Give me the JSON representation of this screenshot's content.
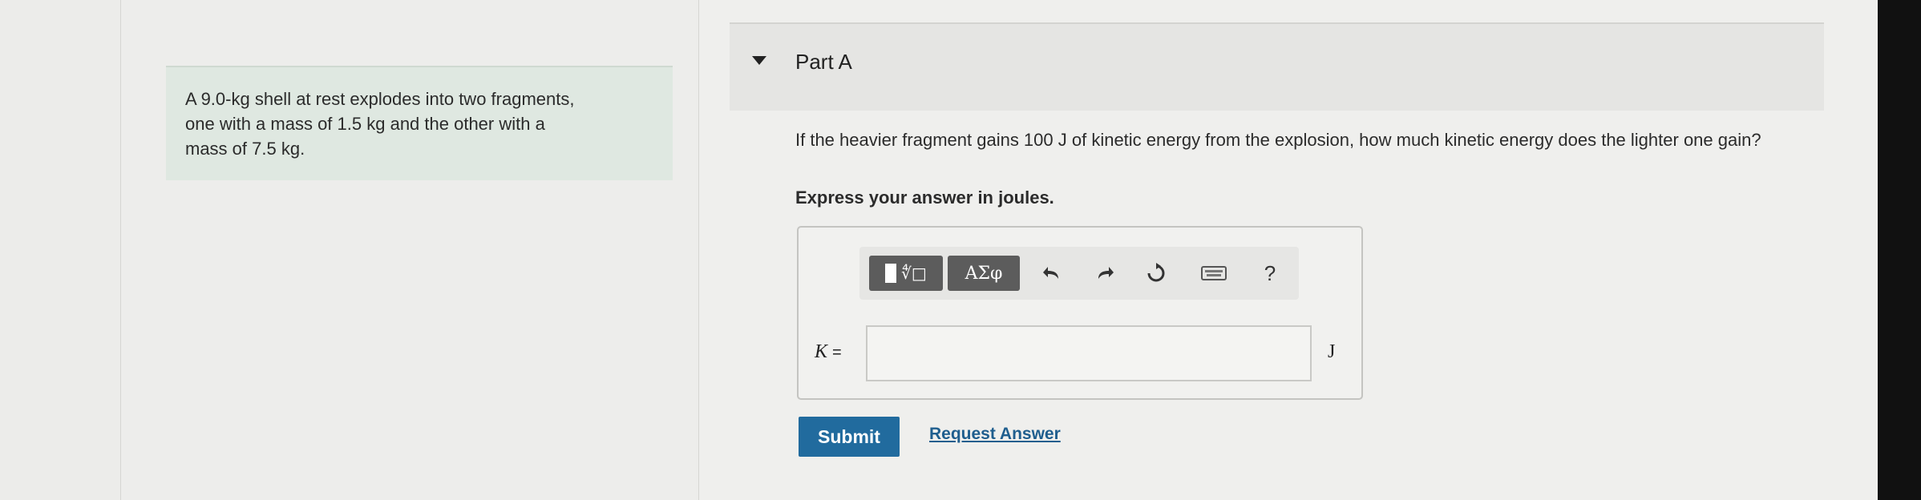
{
  "problem": {
    "lines": [
      "A 9.0-kg shell at rest explodes into two fragments,",
      "one with a mass of 1.5 kg and the other with a",
      "mass of 7.5 kg."
    ]
  },
  "part": {
    "title": "Part A"
  },
  "question": {
    "text": "If the heavier fragment gains 100 J of kinetic energy from the explosion, how much kinetic energy does the lighter one gain?",
    "instruction": "Express your answer in joules."
  },
  "toolbar": {
    "templates_label": "∜□",
    "symbols_label": "ΑΣφ",
    "undo_icon": "undo-icon",
    "redo_icon": "redo-icon",
    "reset_icon": "reset-icon",
    "keyboard_icon": "keyboard-icon",
    "help_label": "?"
  },
  "answer": {
    "variable": "K",
    "equals": "=",
    "value": "",
    "unit": "J"
  },
  "actions": {
    "submit_label": "Submit",
    "request_label": "Request Answer"
  },
  "colors": {
    "submit_bg": "#216b9e",
    "link": "#1f5e8e",
    "problem_bg": "#dfe8e1"
  }
}
